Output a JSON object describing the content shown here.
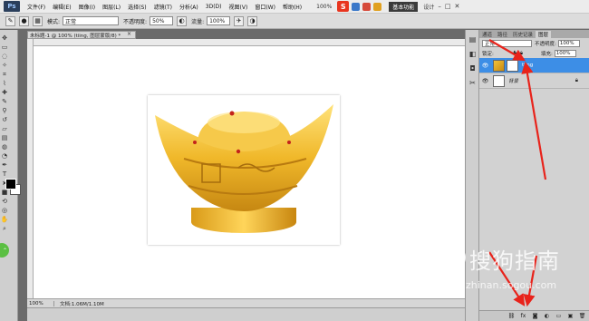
{
  "menubar": {
    "items": [
      "文件(F)",
      "编辑(E)",
      "图像(I)",
      "图层(L)",
      "选择(S)",
      "滤镜(T)",
      "分析(A)",
      "3D(D)",
      "视图(V)",
      "窗口(W)",
      "帮助(H)"
    ],
    "zoom": "100%",
    "workspace_active": "基本功能",
    "workspace_other": "设计",
    "window_controls": [
      "–",
      "□",
      "✕"
    ]
  },
  "options": {
    "mode_label": "模式:",
    "mode_value": "正常",
    "opacity_label": "不透明度:",
    "opacity_value": "50%",
    "flow_label": "流量:",
    "flow_value": "100%"
  },
  "document": {
    "tab_title": "未标题-1 @ 100% (tiing, 图层蒙版/8) *",
    "close": "×",
    "status_zoom": "100%",
    "status_info": "文档:1.06M/1.10M"
  },
  "layers_panel": {
    "tabs": [
      "通道",
      "路径",
      "历史记录",
      "图层"
    ],
    "active_tab": "图层",
    "blend_mode": "正常",
    "opacity_label": "不透明度:",
    "opacity_value": "100%",
    "lock_label": "锁定:",
    "fill_label": "填充:",
    "fill_value": "100%",
    "layers": [
      {
        "name": "tiing",
        "selected": true
      },
      {
        "name": "背景",
        "selected": false
      }
    ]
  },
  "watermark": {
    "text": "搜狗指南",
    "url": "zhinan.sogou.com"
  },
  "colors": {
    "accent_selected": "#3d8ee6",
    "annotation_red": "#e8231b"
  },
  "icons": [
    "brush-icon",
    "move-icon",
    "marquee-icon",
    "lasso-icon",
    "crop-icon",
    "eyedropper-icon",
    "eye-icon",
    "lock-icon",
    "fx-icon",
    "mask-icon",
    "new-layer-icon",
    "trash-icon",
    "sogou-logo"
  ]
}
